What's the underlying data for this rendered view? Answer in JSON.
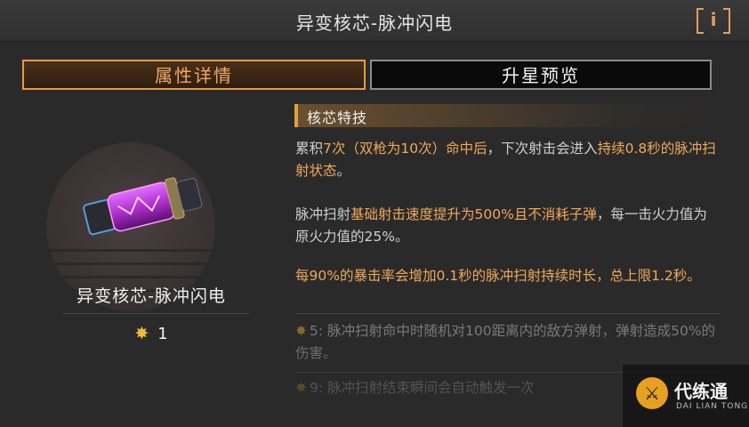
{
  "header": {
    "title": "异变核芯-脉冲闪电",
    "info_label": "i"
  },
  "tabs": [
    {
      "label": "属性详情",
      "active": true
    },
    {
      "label": "升星预览",
      "active": false
    }
  ],
  "item": {
    "name": "异变核芯-脉冲闪电",
    "star_icon": "star-icon",
    "star_count": "1"
  },
  "section": {
    "title": "核芯特技"
  },
  "description": {
    "p1_a": "累积",
    "p1_b": "7次（双枪为10次）命中后",
    "p1_c": "，下次射击会进入",
    "p1_d": "持续0.8秒的脉冲扫射状态",
    "p1_e": "。",
    "p2_a": "脉冲扫射",
    "p2_b": "基础射击速度提升为500%且不消耗子弹",
    "p2_c": "，每一击火力值为原火力值的25%。",
    "p3": "每90%的暴击率会增加0.1秒的脉冲扫射持续时长，总上限1.2秒。",
    "s5": "5: 脉冲扫射命中时随机对100距离内的敌方弹射，弹射造成50%的伤害。",
    "s9": "9: 脉冲扫射结束瞬间会自动触发一次"
  },
  "watermark": {
    "name": "代练通",
    "sub": "DAI LIAN TONG"
  },
  "colors": {
    "accent": "#e89a3c",
    "highlight": "#f0a85a",
    "star": "#f0b93a",
    "item_glow": "#c040e0"
  }
}
